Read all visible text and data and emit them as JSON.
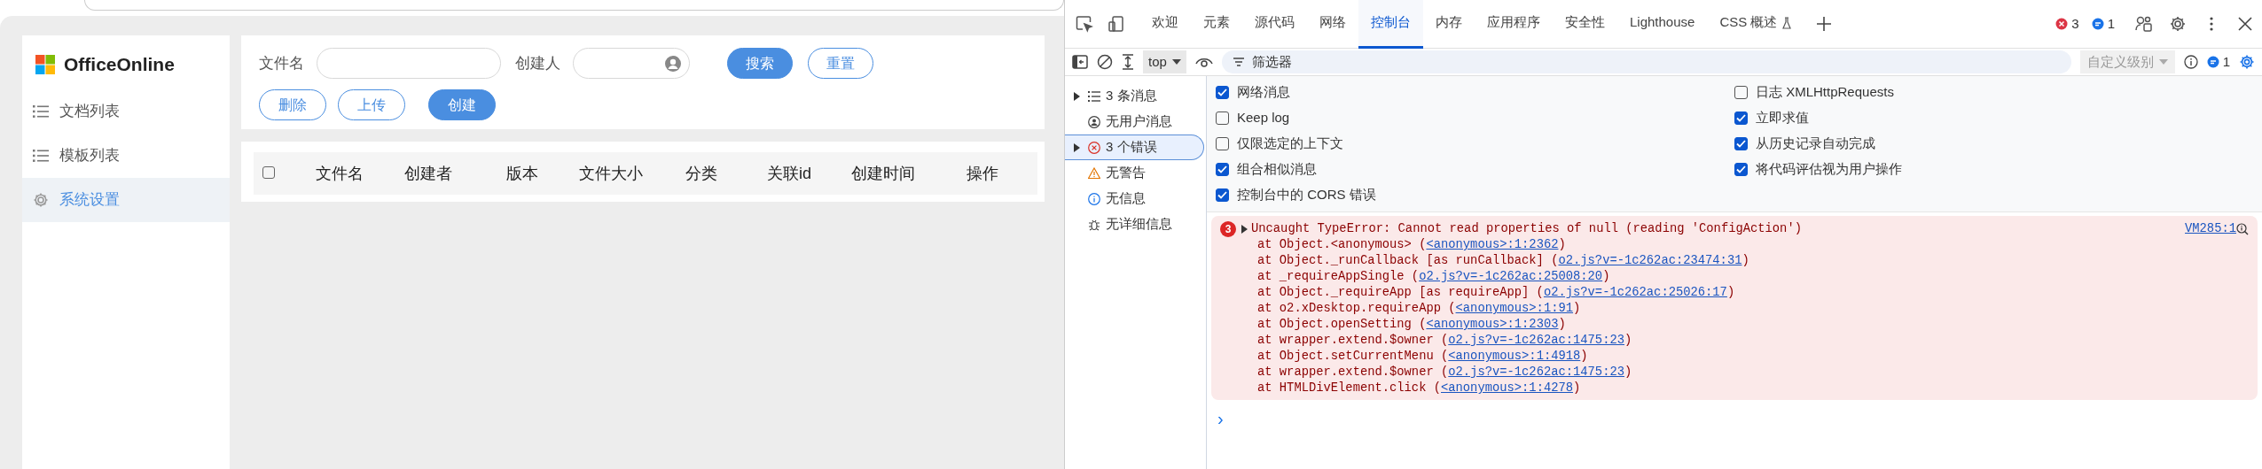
{
  "app": {
    "logo_text": "OfficeOnline",
    "menu": [
      {
        "label": "文档列表",
        "kind": "list",
        "selected": false
      },
      {
        "label": "模板列表",
        "kind": "list",
        "selected": false
      },
      {
        "label": "系统设置",
        "kind": "gear",
        "selected": true
      }
    ],
    "search_fields": [
      {
        "label": "文件名",
        "kind": "text"
      },
      {
        "label": "创建人",
        "kind": "user"
      }
    ],
    "search_buttons": [
      {
        "label": "搜索",
        "primary": true
      },
      {
        "label": "重置",
        "primary": false
      }
    ],
    "actions": [
      {
        "label": "删除",
        "primary": false
      },
      {
        "label": "上传",
        "primary": false
      },
      {
        "label": "创建",
        "primary": true
      }
    ],
    "table": {
      "select_all_checked": false,
      "columns": [
        "文件名",
        "创建者",
        "版本",
        "文件大小",
        "分类",
        "关联id",
        "创建时间",
        "操作"
      ]
    }
  },
  "devtools": {
    "tabs": [
      {
        "label": "欢迎",
        "selected": false
      },
      {
        "label": "元素",
        "selected": false
      },
      {
        "label": "源代码",
        "selected": false
      },
      {
        "label": "网络",
        "selected": false
      },
      {
        "label": "控制台",
        "selected": true
      },
      {
        "label": "内存",
        "selected": false
      },
      {
        "label": "应用程序",
        "selected": false
      },
      {
        "label": "安全性",
        "selected": false
      },
      {
        "label": "Lighthouse",
        "selected": false
      },
      {
        "label": "CSS 概述",
        "selected": false,
        "experimental": true
      }
    ],
    "error_count": "3",
    "info_count": "1",
    "toolbar": {
      "context": "top",
      "filter_placeholder": "筛选器",
      "level": "自定义级别",
      "message_count": "1"
    },
    "sidebar": [
      {
        "label": "3 条消息",
        "kind": "list",
        "expandable": true,
        "selected": false
      },
      {
        "label": "无用户消息",
        "kind": "user",
        "expandable": false,
        "selected": false
      },
      {
        "label": "3 个错误",
        "kind": "error",
        "expandable": true,
        "selected": true
      },
      {
        "label": "无警告",
        "kind": "warning",
        "expandable": false,
        "selected": false
      },
      {
        "label": "无信息",
        "kind": "info",
        "expandable": false,
        "selected": false
      },
      {
        "label": "无详细信息",
        "kind": "verbose",
        "expandable": false,
        "selected": false
      }
    ],
    "settings_left": [
      {
        "label": "网络消息",
        "checked": true
      },
      {
        "label": "Keep log",
        "checked": false
      },
      {
        "label": "仅限选定的上下文",
        "checked": false
      },
      {
        "label": "组合相似消息",
        "checked": true
      },
      {
        "label": "控制台中的 CORS 错误",
        "checked": true
      }
    ],
    "settings_right": [
      {
        "label": "日志 XMLHttpRequests",
        "checked": false
      },
      {
        "label": "立即求值",
        "checked": true
      },
      {
        "label": "从历史记录自动完成",
        "checked": true
      },
      {
        "label": "将代码评估视为用户操作",
        "checked": true
      }
    ],
    "error": {
      "badge": "3",
      "message": "Uncaught TypeError: Cannot read properties of null (reading 'ConfigAction')",
      "source": "VM285:1",
      "stack": [
        {
          "prefix": "at Object.<anonymous> (",
          "link": "<anonymous>:1:2362",
          "suffix": ")"
        },
        {
          "prefix": "at Object._runCallback [as runCallback] (",
          "link": "o2.js?v=-1c262ac:23474:31",
          "suffix": ")"
        },
        {
          "prefix": "at _requireAppSingle (",
          "link": "o2.js?v=-1c262ac:25008:20",
          "suffix": ")"
        },
        {
          "prefix": "at Object._requireApp [as requireApp] (",
          "link": "o2.js?v=-1c262ac:25026:17",
          "suffix": ")"
        },
        {
          "prefix": "at o2.xDesktop.requireApp (",
          "link": "<anonymous>:1:91",
          "suffix": ")"
        },
        {
          "prefix": "at Object.openSetting (",
          "link": "<anonymous>:1:2303",
          "suffix": ")"
        },
        {
          "prefix": "at wrapper.extend.$owner (",
          "link": "o2.js?v=-1c262ac:1475:23",
          "suffix": ")"
        },
        {
          "prefix": "at Object.setCurrentMenu (",
          "link": "<anonymous>:1:4918",
          "suffix": ")"
        },
        {
          "prefix": "at wrapper.extend.$owner (",
          "link": "o2.js?v=-1c262ac:1475:23",
          "suffix": ")"
        },
        {
          "prefix": "at HTMLDivElement.click (",
          "link": "<anonymous>:1:4278",
          "suffix": ")"
        }
      ]
    },
    "prompt": "›"
  }
}
